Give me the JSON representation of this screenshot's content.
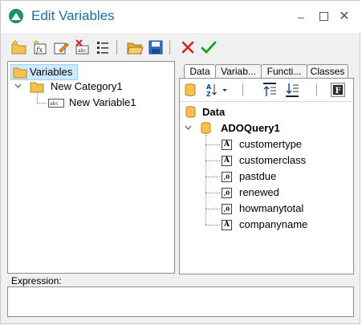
{
  "window": {
    "title": "Edit Variables",
    "accent": "#1b6fa8"
  },
  "toolbar": {
    "icons": [
      "new-category-icon",
      "new-variable-icon",
      "edit-icon",
      "delete-icon",
      "list-icon",
      "open-icon",
      "save-icon",
      "cancel-icon",
      "ok-icon"
    ]
  },
  "variables_tree": {
    "root": "Variables",
    "category": "New Category1",
    "variable": "New Variable1"
  },
  "tabs": [
    {
      "label": "Data",
      "active": true
    },
    {
      "label": "Variab..."
    },
    {
      "label": "Functi..."
    },
    {
      "label": "Classes"
    }
  ],
  "data_tree": {
    "root": "Data",
    "query": "ADOQuery1",
    "fields": [
      {
        "name": "customertype",
        "type": "A"
      },
      {
        "name": "customerclass",
        "type": "A"
      },
      {
        "name": "pastdue",
        "type": ",0"
      },
      {
        "name": "renewed",
        "type": ",0"
      },
      {
        "name": "howmanytotal",
        "type": ",0"
      },
      {
        "name": "companyname",
        "type": "A"
      }
    ]
  },
  "expression": {
    "label": "Expression:",
    "value": ""
  }
}
